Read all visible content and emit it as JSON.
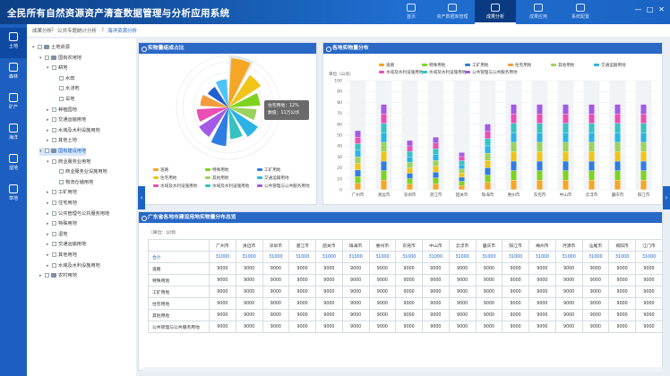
{
  "header": {
    "title": "全民所有自然资源资产清查数据管理与分析应用系统",
    "tabs": [
      {
        "label": "首页",
        "icon": "home-icon"
      },
      {
        "label": "资产数据库管理",
        "icon": "database-icon"
      },
      {
        "label": "成果分析",
        "icon": "chart-icon",
        "active": true
      },
      {
        "label": "成果应用",
        "icon": "apps-icon"
      },
      {
        "label": "系统配置",
        "icon": "settings-icon"
      }
    ],
    "window_controls": [
      "—",
      "□",
      "✕"
    ]
  },
  "left_nav": [
    {
      "label": "土地",
      "icon": "land-icon",
      "active": true
    },
    {
      "label": "森林",
      "icon": "forest-icon"
    },
    {
      "label": "矿产",
      "icon": "mineral-icon"
    },
    {
      "label": "海洋",
      "icon": "ocean-icon"
    },
    {
      "label": "湿地",
      "icon": "wetland-icon"
    },
    {
      "label": "草地",
      "icon": "grass-icon"
    }
  ],
  "breadcrumb": [
    "成果分析",
    "公共专题统计分析",
    "海洋资源分析"
  ],
  "tree": [
    {
      "label": "土地资源",
      "level": 0,
      "arrow": "▾"
    },
    {
      "label": "国有农用地",
      "level": 1,
      "arrow": "▾"
    },
    {
      "label": "耕地",
      "level": 2,
      "arrow": "▾"
    },
    {
      "label": "水田",
      "level": 3,
      "arrow": ""
    },
    {
      "label": "水浇地",
      "level": 3,
      "arrow": ""
    },
    {
      "label": "旱地",
      "level": 3,
      "arrow": ""
    },
    {
      "label": "种植园地",
      "level": 2,
      "arrow": "▸"
    },
    {
      "label": "交通运输用地",
      "level": 2,
      "arrow": "▸"
    },
    {
      "label": "水域及水利设施用地",
      "level": 2,
      "arrow": "▸"
    },
    {
      "label": "其他土地",
      "level": 2,
      "arrow": "▸"
    },
    {
      "label": "国有建设用地",
      "level": 1,
      "arrow": "▾",
      "selected": true
    },
    {
      "label": "商业服务业用地",
      "level": 2,
      "arrow": "▾"
    },
    {
      "label": "商业服务业设施用地",
      "level": 3,
      "arrow": ""
    },
    {
      "label": "物流仓储用地",
      "level": 3,
      "arrow": ""
    },
    {
      "label": "工矿用地",
      "level": 2,
      "arrow": "▸"
    },
    {
      "label": "住宅用地",
      "level": 2,
      "arrow": "▸"
    },
    {
      "label": "公共管理与公共服务用地",
      "level": 2,
      "arrow": "▸"
    },
    {
      "label": "特殊用地",
      "level": 2,
      "arrow": "▸"
    },
    {
      "label": "湿地",
      "level": 2,
      "arrow": "▸"
    },
    {
      "label": "交通运输用地",
      "level": 2,
      "arrow": "▸"
    },
    {
      "label": "其他用地",
      "level": 2,
      "arrow": "▸"
    },
    {
      "label": "水域及水利设施用地",
      "level": 2,
      "arrow": "▸"
    },
    {
      "label": "农村用地",
      "level": 1,
      "arrow": "▸"
    }
  ],
  "pie_panel": {
    "title": "实物量组成占比",
    "tooltip_line1": "住宅用地：12%",
    "tooltip_line2": "数值：11万公顷",
    "legend": [
      {
        "label": "道路",
        "color": "#f5a623"
      },
      {
        "label": "特殊用地",
        "color": "#7ed321"
      },
      {
        "label": "工矿用地",
        "color": "#2f7de1"
      },
      {
        "label": "住宅用地",
        "color": "#f0c419"
      },
      {
        "label": "其他用地",
        "color": "#9bd35a"
      },
      {
        "label": "交通运输用地",
        "color": "#2bb3e6"
      },
      {
        "label": "水域及水利设施用地",
        "color": "#e94fb5"
      },
      {
        "label": "水域及水利设施用地",
        "color": "#36c2c2"
      },
      {
        "label": "公共管理与公共服务用地",
        "color": "#a35ae6"
      }
    ]
  },
  "bar_panel": {
    "title": "各地实物量分布",
    "ylabel": "单位（公顷）",
    "legend": [
      {
        "label": "道路",
        "color": "#f5a623"
      },
      {
        "label": "特殊用地",
        "color": "#7ed321"
      },
      {
        "label": "工矿用地",
        "color": "#2f7de1"
      },
      {
        "label": "住宅用地",
        "color": "#f39c3d"
      },
      {
        "label": "其他用地",
        "color": "#9bd35a"
      },
      {
        "label": "交通运输用地",
        "color": "#2bb3e6"
      },
      {
        "label": "水域及水利设施用地",
        "color": "#e94fb5"
      },
      {
        "label": "水域及水利设施用地",
        "color": "#36c2c2"
      },
      {
        "label": "公共管理与公共服务用地",
        "color": "#a35ae6"
      }
    ]
  },
  "table_panel": {
    "title": "广东省各地市建设用地实物量分布总览",
    "unit": "（单位：公顷）",
    "columns": [
      "广州市",
      "清远市",
      "深圳市",
      "湛江市",
      "韶关市",
      "珠海市",
      "惠州市",
      "东莞市",
      "中山市",
      "云浮市",
      "肇庆市",
      "阳江市",
      "梅州市",
      "河源市",
      "汕尾市",
      "揭阳市",
      "江门市"
    ],
    "rows": [
      {
        "label": "合计",
        "total": true,
        "values": [
          "31000",
          "31000",
          "31000",
          "31000",
          "31000",
          "31000",
          "31000",
          "31000",
          "31000",
          "31000",
          "31000",
          "31000",
          "31000",
          "31000",
          "31000",
          "31000",
          "31000"
        ]
      },
      {
        "label": "道路",
        "values": [
          "9000",
          "9000",
          "9000",
          "9000",
          "9000",
          "9000",
          "9000",
          "9000",
          "9000",
          "9000",
          "9000",
          "9000",
          "9000",
          "9000",
          "9000",
          "9000",
          "9000"
        ]
      },
      {
        "label": "特殊用地",
        "values": [
          "9000",
          "9000",
          "9000",
          "9000",
          "9000",
          "9000",
          "9000",
          "9000",
          "9000",
          "9000",
          "9000",
          "9000",
          "9000",
          "9000",
          "9000",
          "9000",
          "9000"
        ]
      },
      {
        "label": "工矿用地",
        "values": [
          "9000",
          "9000",
          "9000",
          "9000",
          "9000",
          "9000",
          "9000",
          "9000",
          "9000",
          "9000",
          "9000",
          "9000",
          "9000",
          "9000",
          "9000",
          "9000",
          "9000"
        ]
      },
      {
        "label": "住宅用地",
        "values": [
          "9000",
          "9000",
          "9000",
          "9000",
          "9000",
          "9000",
          "9000",
          "9000",
          "9000",
          "9000",
          "9000",
          "9000",
          "9000",
          "9000",
          "9000",
          "9000",
          "9000"
        ]
      },
      {
        "label": "其他用地",
        "values": [
          "9000",
          "9000",
          "9000",
          "9000",
          "9000",
          "9000",
          "9000",
          "9000",
          "9000",
          "9000",
          "9000",
          "9000",
          "9000",
          "9000",
          "9000",
          "9000",
          "9000"
        ]
      },
      {
        "label": "公共管理与公共服务用地",
        "values": [
          "9000",
          "9000",
          "9000",
          "9000",
          "9000",
          "9000",
          "9000",
          "9000",
          "9000",
          "9000",
          "9000",
          "9000",
          "9000",
          "9000",
          "9000",
          "9000",
          "9000"
        ]
      }
    ]
  },
  "chart_data": [
    {
      "type": "pie",
      "variant": "nightingale-rose",
      "slices": [
        {
          "label": "住宅用地",
          "value": 12,
          "color": "#f5a623"
        },
        {
          "label": "道路",
          "value": 9,
          "color": "#f0c419"
        },
        {
          "label": "特殊用地",
          "value": 7,
          "color": "#7ed321"
        },
        {
          "label": "其他用地",
          "value": 6,
          "color": "#9bd35a"
        },
        {
          "label": "交通运输用地",
          "value": 8,
          "color": "#2bb3e6"
        },
        {
          "label": "水域及水利设施用地",
          "value": 7,
          "color": "#36c2c2"
        },
        {
          "label": "工矿用地",
          "value": 9,
          "color": "#2f7de1"
        },
        {
          "label": "公共管理与公共服务用地",
          "value": 8,
          "color": "#a35ae6"
        },
        {
          "label": "水域及水利设施用地",
          "value": 7,
          "color": "#e94fb5"
        },
        {
          "label": "道路",
          "value": 6,
          "color": "#f39c3d"
        },
        {
          "label": "工矿用地",
          "value": 5,
          "color": "#1f5fd0"
        },
        {
          "label": "其他用地",
          "value": 6,
          "color": "#4fc3f7"
        }
      ]
    },
    {
      "type": "bar",
      "stacked": true,
      "categories": [
        "广州市",
        "清远市",
        "深圳市",
        "湛江市",
        "韶关市",
        "珠海市",
        "惠州市",
        "东莞市",
        "中山市",
        "云浮市",
        "肇庆市",
        "阳江市"
      ],
      "ylim": [
        0,
        100
      ],
      "yticks": [
        0,
        10,
        20,
        30,
        40,
        50,
        60,
        70,
        80,
        90,
        100
      ],
      "ylabel": "单位（公顷）",
      "totals": [
        54,
        78,
        45,
        48,
        34,
        60,
        78,
        78,
        78,
        78,
        78,
        78
      ],
      "series_colors": [
        "#f5a623",
        "#7ed321",
        "#2f7de1",
        "#f0c419",
        "#9bd35a",
        "#2bb3e6",
        "#36c2c2",
        "#e94fb5",
        "#a35ae6"
      ]
    }
  ]
}
